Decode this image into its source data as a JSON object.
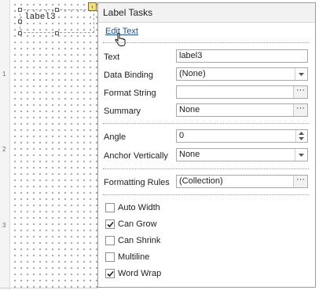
{
  "designer": {
    "label_text": "label3",
    "ruler_marks": [
      "1",
      "2",
      "3"
    ]
  },
  "panel": {
    "title": "Label Tasks",
    "edit_link": "Edit Text",
    "rows": {
      "text": {
        "label": "Text",
        "value": "label3"
      },
      "data_binding": {
        "label": "Data Binding",
        "value": "(None)"
      },
      "format_string": {
        "label": "Format String",
        "value": ""
      },
      "summary": {
        "label": "Summary",
        "value": "None"
      },
      "angle": {
        "label": "Angle",
        "value": "0"
      },
      "anchor_vertically": {
        "label": "Anchor Vertically",
        "value": "None"
      },
      "formatting_rules": {
        "label": "Formatting Rules",
        "value": "(Collection)"
      }
    },
    "ellipsis": "···",
    "checkboxes": [
      {
        "label": "Auto Width",
        "checked": false
      },
      {
        "label": "Can Grow",
        "checked": true
      },
      {
        "label": "Can Shrink",
        "checked": false
      },
      {
        "label": "Multiline",
        "checked": false
      },
      {
        "label": "Word Wrap",
        "checked": true
      }
    ]
  }
}
